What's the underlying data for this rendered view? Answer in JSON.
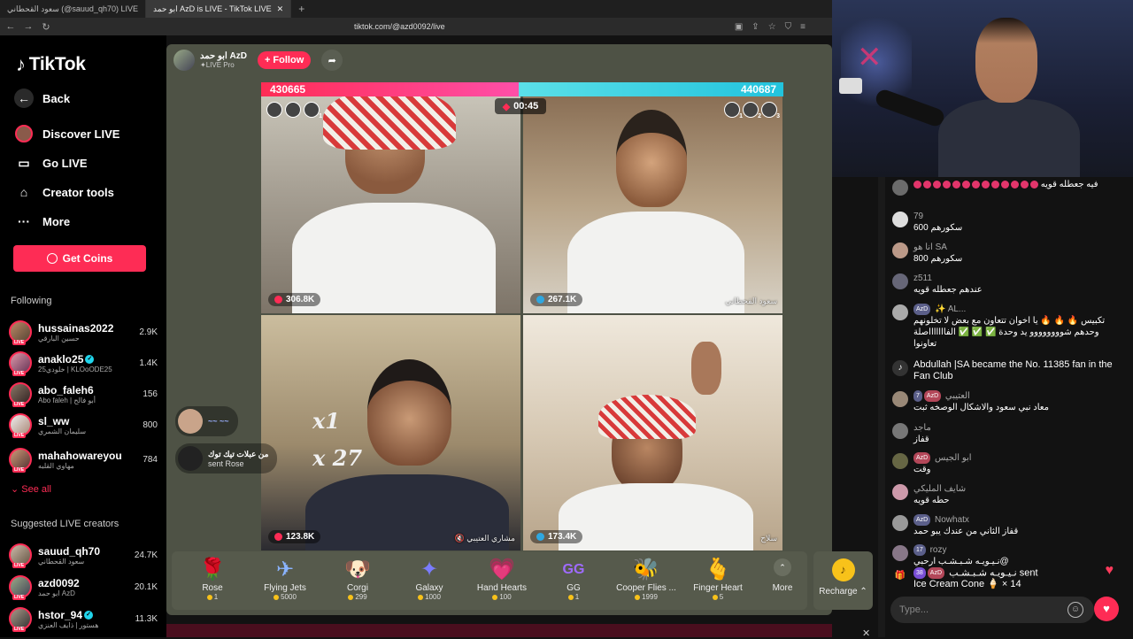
{
  "browser": {
    "tabs": [
      {
        "label": "سعود القحطاني (@sauud_qh70) LIVE",
        "active": false
      },
      {
        "label": "ابو حمد AzD is LIVE - TikTok LIVE",
        "active": true
      }
    ],
    "url": "tiktok.com/@azd0092/live"
  },
  "sidebar": {
    "logo": "TikTok",
    "nav": [
      {
        "label": "Back",
        "icon": "back-arrow-icon"
      },
      {
        "label": "Discover LIVE",
        "icon": "live-avatar-icon"
      },
      {
        "label": "Go LIVE",
        "icon": "camera-icon"
      },
      {
        "label": "Creator tools",
        "icon": "creator-tools-icon"
      },
      {
        "label": "More",
        "icon": "ellipsis-icon"
      }
    ],
    "get_coins": "Get Coins",
    "following_title": "Following",
    "following": [
      {
        "name": "hussainas2022",
        "sub": "حسين البارقي",
        "count": "2.9K",
        "verified": false
      },
      {
        "name": "anaklo25",
        "sub": "خلودي25 | KLOoODE25",
        "count": "1.4K",
        "verified": true
      },
      {
        "name": "abo_faleh6",
        "sub": "Abo faleh | أبو فالح",
        "count": "156",
        "verified": false
      },
      {
        "name": "sl_ww",
        "sub": "سليمان الشمري",
        "count": "800",
        "verified": false
      },
      {
        "name": "mahahowareyou",
        "sub": "مهاوي القلبه",
        "count": "784",
        "verified": false
      }
    ],
    "see_all": "See all",
    "suggested_title": "Suggested LIVE creators",
    "suggested": [
      {
        "name": "sauud_qh70",
        "sub": "سعود القحطاني",
        "count": "24.7K",
        "verified": false
      },
      {
        "name": "azd0092",
        "sub": "ابو حمد AzD",
        "count": "20.1K",
        "verified": false
      },
      {
        "name": "hstor_94",
        "sub": "هستور | ذايف العنزي",
        "count": "11.3K",
        "verified": true
      }
    ]
  },
  "live": {
    "host_name": "ابو حمد AzD",
    "host_sub": "LIVE Pro",
    "follow": "+ Follow",
    "score_left": "430665",
    "score_right": "440687",
    "timer": "00:45",
    "tiles": [
      {
        "points": "306.8K",
        "name": ""
      },
      {
        "points": "267.1K",
        "name": "سعود القحطاني"
      },
      {
        "points": "123.8K",
        "name": "مشاري العتيبي"
      },
      {
        "points": "173.4K",
        "name": "سلاح"
      }
    ],
    "left_mini": [
      "",
      "",
      "1"
    ],
    "right_mini": [
      "1",
      "2",
      "3"
    ],
    "gift_events": [
      {
        "user": "~~ ~~",
        "action": "",
        "count": "x1"
      },
      {
        "user": "من عبلات تيك توك",
        "action": "sent Rose",
        "count": "x 27"
      }
    ]
  },
  "gifts": [
    {
      "name": "Rose",
      "price": "1",
      "icon": "rose-icon",
      "glyph": "🌹"
    },
    {
      "name": "Flying Jets",
      "price": "5000",
      "icon": "jets-icon",
      "glyph": "✈"
    },
    {
      "name": "Corgi",
      "price": "299",
      "icon": "corgi-icon",
      "glyph": "🐶"
    },
    {
      "name": "Galaxy",
      "price": "1000",
      "icon": "galaxy-icon",
      "glyph": "✦"
    },
    {
      "name": "Hand Hearts",
      "price": "100",
      "icon": "hand-hearts-icon",
      "glyph": "💗"
    },
    {
      "name": "GG",
      "price": "1",
      "icon": "gg-icon",
      "glyph": "GG"
    },
    {
      "name": "Cooper Flies ...",
      "price": "1999",
      "icon": "cooper-icon",
      "glyph": "🐝"
    },
    {
      "name": "Finger Heart",
      "price": "5",
      "icon": "finger-heart-icon",
      "glyph": "🫰"
    }
  ],
  "more_label": "More",
  "recharge_label": "Recharge",
  "chat": {
    "messages": [
      {
        "user": "",
        "badges": [],
        "text": "فيه جعطله قويه",
        "dots": 13
      },
      {
        "user": "79",
        "badges": [],
        "text": "سكورهم 600"
      },
      {
        "user": "انا هو SA",
        "badges": [],
        "text": "سكورهم 800"
      },
      {
        "user": "z511",
        "badges": [],
        "text": "عندهم جعطله قويه"
      },
      {
        "user": "AL...",
        "badges": [
          "AzD"
        ],
        "text": "تكبيس 🔥 🔥 🔥 يا اخوان تتعاون مع بعض لا تخلونهم وحدهم شوووووووو يد وحدة ✅ ✅ ✅ الفاااااااصلة تعاونوا"
      },
      {
        "user": "",
        "badges": [],
        "text": "Abdullah |SA became the No. 11385 fan in the Fan Club",
        "system": true
      },
      {
        "user": "العتيبي",
        "badges": [
          "7",
          "AzD"
        ],
        "text": "معاد نبي سعود والاشكال الوصخه ثبت"
      },
      {
        "user": "ماجد",
        "badges": [],
        "text": "قفاز"
      },
      {
        "user": "ابو الجيس",
        "badges": [
          "AzD"
        ],
        "text": "وقت"
      },
      {
        "user": "شايف المليكي",
        "badges": [],
        "text": "حطه قويه"
      },
      {
        "user": "Nowhatx",
        "badges": [
          "AzD"
        ],
        "text": "قفاز الثاني من عندك يبو حمد"
      },
      {
        "user": "rozy",
        "badges": [
          "17"
        ],
        "text": "@نـيـويـه شـبـشـب ارحبي"
      },
      {
        "user": "",
        "badges": [
          "38",
          "AzD"
        ],
        "text": "نـيـويـه شـبـشـب sent",
        "gift_line": "Ice Cream Cone 🍦 × 14"
      }
    ],
    "input_placeholder": "Type..."
  }
}
